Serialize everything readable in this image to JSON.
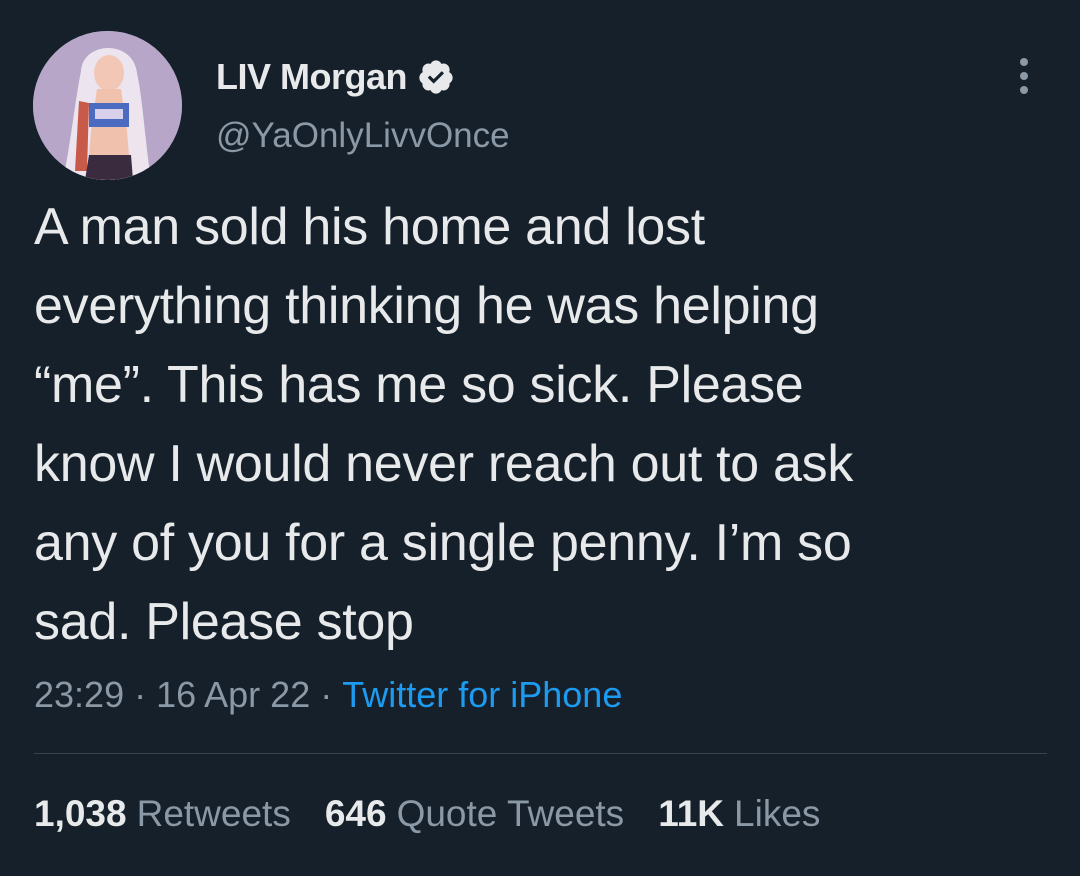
{
  "author": {
    "display_name": "LIV Morgan",
    "handle": "@YaOnlyLivvOnce",
    "verified": true,
    "avatar_icon": "user-avatar-image"
  },
  "tweet": {
    "text": "A man sold his home and lost\neverything thinking he was helping\n“me”. This has me so sick. Please\nknow I would never reach out to ask\nany of you for a single penny. I’m so\nsad. Please stop",
    "time": "23:29",
    "date": "16 Apr 22",
    "separator": "·",
    "source": "Twitter for iPhone"
  },
  "stats": {
    "retweets": {
      "count": "1,038",
      "label": "Retweets"
    },
    "quote_tweets": {
      "count": "646",
      "label": "Quote Tweets"
    },
    "likes": {
      "count": "11K",
      "label": "Likes"
    }
  },
  "colors": {
    "background": "#15202b",
    "text_primary": "#e7e9ea",
    "text_secondary": "#8b98a5",
    "link": "#1d9bf0",
    "divider": "#38444d"
  },
  "icons": {
    "verified": "verified-badge-icon",
    "more": "more-options-icon"
  }
}
